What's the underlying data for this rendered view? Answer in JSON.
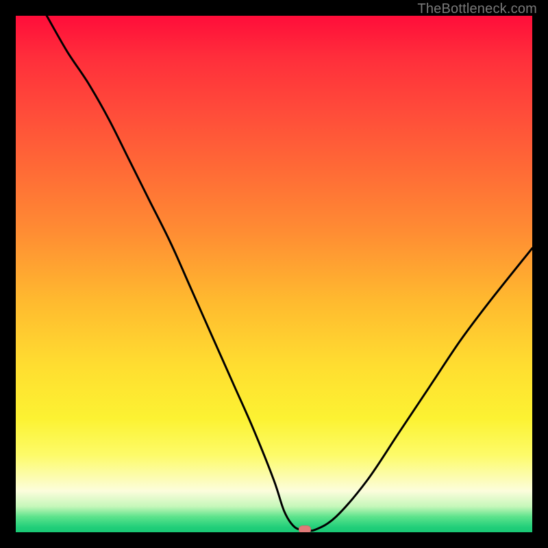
{
  "watermark": {
    "text": "TheBottleneck.com"
  },
  "chart_data": {
    "type": "line",
    "title": "",
    "xlabel": "",
    "ylabel": "",
    "xlim": [
      0,
      100
    ],
    "ylim": [
      0,
      100
    ],
    "grid": false,
    "legend": false,
    "background": "rainbow-vertical-gradient",
    "series": [
      {
        "name": "bottleneck-curve",
        "x": [
          6,
          10,
          14,
          18,
          22,
          26,
          30,
          34,
          38,
          42,
          46,
          50,
          52,
          54,
          56,
          58,
          62,
          68,
          74,
          80,
          86,
          92,
          100
        ],
        "y": [
          100,
          93,
          87,
          80,
          72,
          64,
          56,
          47,
          38,
          29,
          20,
          10,
          4,
          1,
          0.5,
          0.5,
          3,
          10,
          19,
          28,
          37,
          45,
          55
        ]
      }
    ],
    "annotations": [
      {
        "type": "marker",
        "shape": "pill",
        "x": 56,
        "y": 0.5,
        "color": "#e07a78"
      }
    ]
  }
}
